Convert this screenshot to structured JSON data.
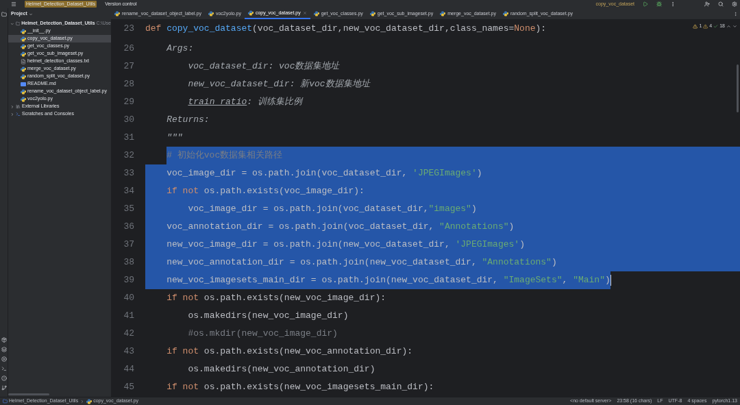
{
  "title_bar": {
    "project": "Helmet_Detection_Dataset_Utils",
    "vcs": "Version control",
    "run_config": "copy_voc_dataset"
  },
  "project_panel": {
    "title": "Project",
    "root": {
      "label": "Helmet_Detection_Dataset_Utils",
      "path": "C:\\Use",
      "expanded": true,
      "children": [
        {
          "label": "__init__.py",
          "kind": "py",
          "selected": false
        },
        {
          "label": "copy_voc_dataset.py",
          "kind": "py",
          "selected": true
        },
        {
          "label": "get_voc_classes.py",
          "kind": "py",
          "selected": false
        },
        {
          "label": "get_voc_sub_imageset.py",
          "kind": "py",
          "selected": false
        },
        {
          "label": "helmet_detection_classes.txt",
          "kind": "txt",
          "selected": false
        },
        {
          "label": "merge_voc_dataset.py",
          "kind": "py",
          "selected": false
        },
        {
          "label": "random_split_voc_dataset.py",
          "kind": "py",
          "selected": false
        },
        {
          "label": "README.md",
          "kind": "md",
          "selected": false
        },
        {
          "label": "rename_voc_dataset_object_label.py",
          "kind": "py",
          "selected": false
        },
        {
          "label": "voc2yolo.py",
          "kind": "py",
          "selected": false
        }
      ]
    },
    "others": [
      {
        "label": "External Libraries",
        "kind": "library",
        "expanded": false
      },
      {
        "label": "Scratches and Consoles",
        "kind": "scratch",
        "expanded": false
      }
    ]
  },
  "tabs": [
    {
      "label": "rename_voc_dataset_object_label.py",
      "selected": false
    },
    {
      "label": "voc2yolo.py",
      "selected": false
    },
    {
      "label": "copy_voc_dataset.py",
      "selected": true
    },
    {
      "label": "get_voc_classes.py",
      "selected": false
    },
    {
      "label": "get_voc_sub_imageset.py",
      "selected": false
    },
    {
      "label": "merge_voc_dataset.py",
      "selected": false
    },
    {
      "label": "random_split_voc_dataset.py",
      "selected": false
    }
  ],
  "inspections": {
    "errors": "1",
    "warnings": "4",
    "passed": "18"
  },
  "code_lines": [
    {
      "number": "23",
      "selected": false,
      "tokens": [
        {
          "kind": "kw",
          "text": "def "
        },
        {
          "kind": "fn",
          "text": "copy_voc_dataset"
        },
        {
          "kind": "plain",
          "text": "(voc_dataset_dir,new_voc_dataset_dir,class_names="
        },
        {
          "kind": "kw",
          "text": "None"
        },
        {
          "kind": "plain",
          "text": "):"
        }
      ]
    },
    {
      "number": "26",
      "selected": false,
      "tokens": [
        {
          "kind": "doc",
          "text": "    Args:"
        }
      ]
    },
    {
      "number": "27",
      "selected": false,
      "tokens": [
        {
          "kind": "doc",
          "text": "        voc_dataset_dir: voc数据集地址"
        }
      ]
    },
    {
      "number": "28",
      "selected": false,
      "tokens": [
        {
          "kind": "doc",
          "text": "        new_voc_dataset_dir: 新voc数据集地址"
        }
      ]
    },
    {
      "number": "29",
      "selected": false,
      "tokens": [
        {
          "kind": "docref",
          "text": "        train_ratio"
        },
        {
          "kind": "doc",
          "text": ": 训练集比例"
        }
      ]
    },
    {
      "number": "30",
      "selected": false,
      "tokens": [
        {
          "kind": "doc",
          "text": "    Returns:"
        }
      ]
    },
    {
      "number": "31",
      "selected": false,
      "tokens": [
        {
          "kind": "doc",
          "text": "    \"\"\""
        }
      ]
    },
    {
      "number": "32",
      "selected": true,
      "tokens": [
        {
          "kind": "comment",
          "text": "    # 初始化voc数据集相关路径"
        }
      ]
    },
    {
      "number": "33",
      "selected": true,
      "tokens": [
        {
          "kind": "plain",
          "text": "    voc_image_dir = os.path.join(voc_dataset_dir, "
        },
        {
          "kind": "str",
          "text": "'JPEGImages'"
        },
        {
          "kind": "plain",
          "text": ")"
        }
      ]
    },
    {
      "number": "34",
      "selected": true,
      "tokens": [
        {
          "kind": "kw",
          "text": "    if not "
        },
        {
          "kind": "plain",
          "text": "os.path.exists(voc_image_dir):"
        }
      ]
    },
    {
      "number": "35",
      "selected": true,
      "tokens": [
        {
          "kind": "plain",
          "text": "        voc_image_dir = os.path.join(voc_dataset_dir,"
        },
        {
          "kind": "str",
          "text": "\"images\""
        },
        {
          "kind": "plain",
          "text": ")"
        }
      ]
    },
    {
      "number": "36",
      "selected": true,
      "tokens": [
        {
          "kind": "plain",
          "text": "    voc_annotation_dir = os.path.join(voc_dataset_dir, "
        },
        {
          "kind": "str",
          "text": "\"Annotations\""
        },
        {
          "kind": "plain",
          "text": ")"
        }
      ]
    },
    {
      "number": "37",
      "selected": true,
      "tokens": [
        {
          "kind": "plain",
          "text": "    new_voc_image_dir = os.path.join(new_voc_dataset_dir, "
        },
        {
          "kind": "str",
          "text": "'JPEGImages'"
        },
        {
          "kind": "plain",
          "text": ")"
        }
      ]
    },
    {
      "number": "38",
      "selected": true,
      "tokens": [
        {
          "kind": "plain",
          "text": "    new_voc_annotation_dir = os.path.join(new_voc_dataset_dir, "
        },
        {
          "kind": "str",
          "text": "\"Annotations\""
        },
        {
          "kind": "plain",
          "text": ")"
        }
      ]
    },
    {
      "number": "39",
      "selected": true,
      "tokens": [
        {
          "kind": "plain",
          "text": "    new_voc_imagesets_main_dir = os.path.join(new_voc_dataset_dir, "
        },
        {
          "kind": "str",
          "text": "\"ImageSets\""
        },
        {
          "kind": "plain",
          "text": ", "
        },
        {
          "kind": "str",
          "text": "\"Main\""
        },
        {
          "kind": "plain",
          "text": ")"
        }
      ]
    },
    {
      "number": "40",
      "selected": false,
      "tokens": [
        {
          "kind": "kw",
          "text": "    if not "
        },
        {
          "kind": "plain",
          "text": "os.path.exists(new_voc_image_dir):"
        }
      ]
    },
    {
      "number": "41",
      "selected": false,
      "tokens": [
        {
          "kind": "plain",
          "text": "        os.makedirs(new_voc_image_dir)"
        }
      ]
    },
    {
      "number": "42",
      "selected": false,
      "tokens": [
        {
          "kind": "comment",
          "text": "        #os.mkdir(new_voc_image_dir)"
        }
      ]
    },
    {
      "number": "43",
      "selected": false,
      "tokens": [
        {
          "kind": "kw",
          "text": "    if not "
        },
        {
          "kind": "plain",
          "text": "os.path.exists(new_voc_annotation_dir):"
        }
      ]
    },
    {
      "number": "44",
      "selected": false,
      "tokens": [
        {
          "kind": "plain",
          "text": "        os.makedirs(new_voc_annotation_dir)"
        }
      ]
    },
    {
      "number": "45",
      "selected": false,
      "tokens": [
        {
          "kind": "kw",
          "text": "    if not "
        },
        {
          "kind": "plain",
          "text": "os.path.exists(new_voc_imagesets_main_dir):"
        }
      ]
    }
  ],
  "status_bar": {
    "breadcrumbs": [
      "Helmet_Detection_Dataset_Utils",
      "copy_voc_dataset.py"
    ],
    "items": [
      "<no default server>",
      "23:58 (16 chars)",
      "LF",
      "UTF-8",
      "4 spaces",
      "pytorch1.13"
    ]
  }
}
